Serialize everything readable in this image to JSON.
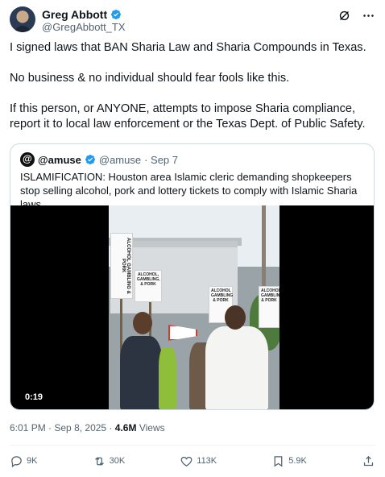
{
  "author": {
    "name": "Greg Abbott",
    "handle": "@GregAbbott_TX"
  },
  "header_icons": [
    "grok-icon",
    "more-icon"
  ],
  "tweet": {
    "paragraphs": [
      "I signed laws that BAN Sharia Law and Sharia Compounds in Texas.",
      "No business & no individual should fear fools like this.",
      "If this person, or ANYONE, attempts to impose Sharia compliance, report it to local law enforcement or the Texas Dept. of Public Safety."
    ]
  },
  "quote": {
    "name": "@amuse",
    "handle": "@amuse",
    "date": "· Sep 7",
    "text": "ISLAMIFICATION: Houston area Islamic cleric demanding shopkeepers stop selling alcohol, pork and lottery tickets to comply with Islamic Sharia laws.",
    "video": {
      "timecode": "0:19",
      "sign_text_1": "ALCOHOL GAMBLING & PORK",
      "sign_text_2": "ALCOHOL, GAMBLING, & PORK",
      "sign_text_3": "ALCOHOL GAMBLING & PORK",
      "sign_text_4": "ALCOHOL GAMBLING & PORK"
    }
  },
  "meta": {
    "time": "6:01 PM",
    "date": "· Sep 8, 2025 ·",
    "views_count": "4.6M",
    "views_label": "Views"
  },
  "actions": {
    "replies": "9K",
    "reposts": "30K",
    "likes": "113K",
    "bookmarks": "5.9K"
  },
  "colors": {
    "verified": "#1d9bf0",
    "secondary_text": "#536471",
    "border": "#cfd9de"
  }
}
